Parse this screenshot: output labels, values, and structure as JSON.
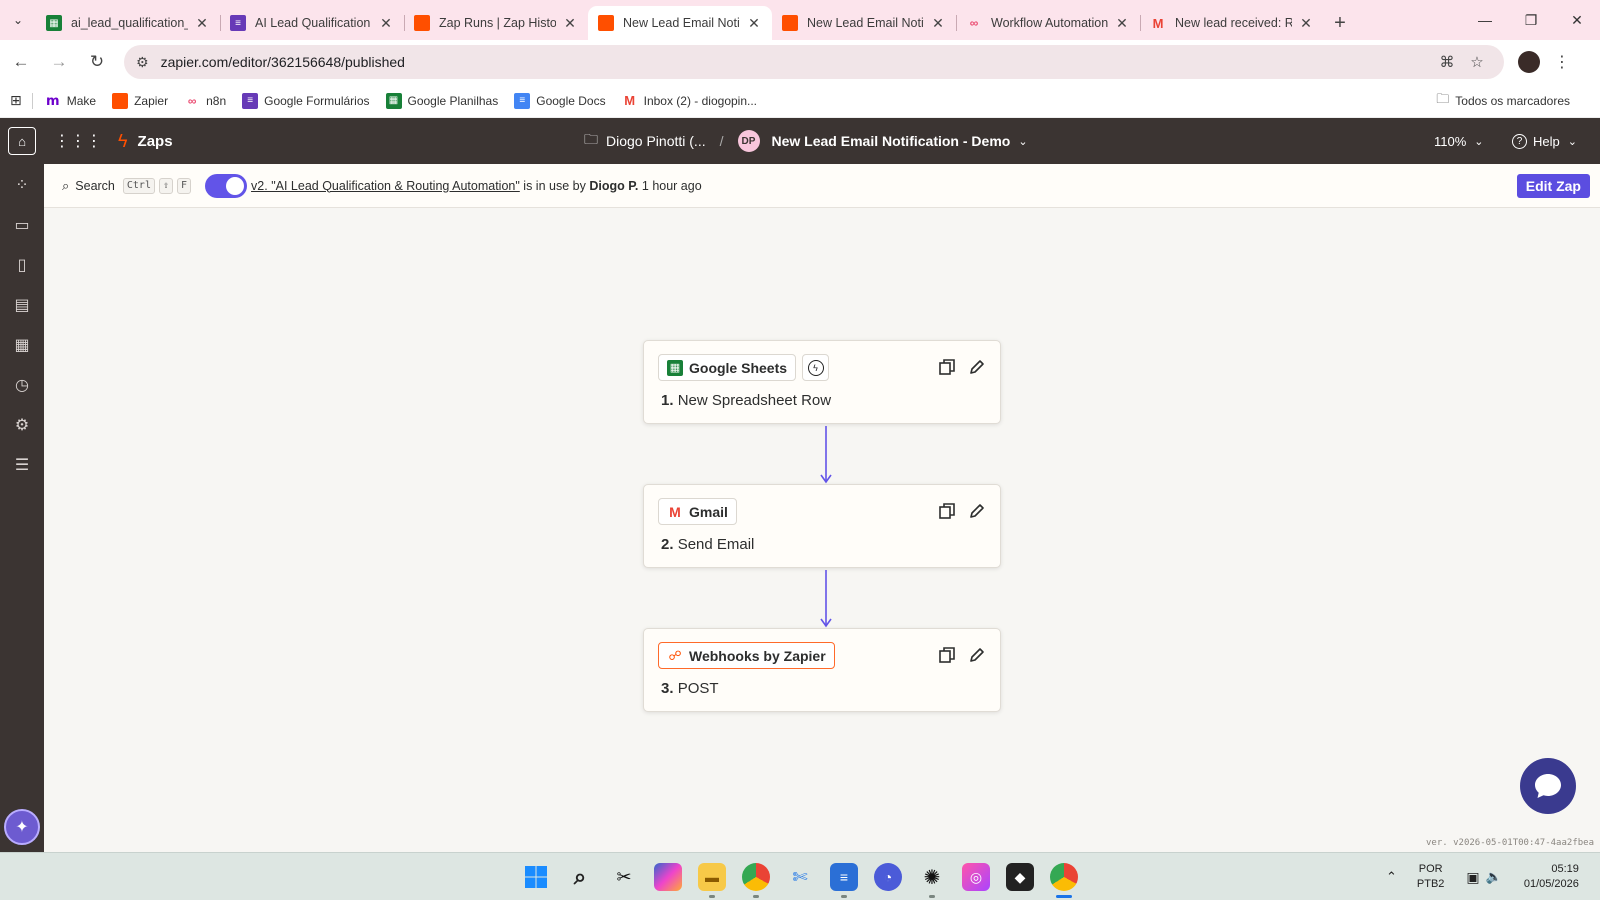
{
  "browser": {
    "tabs": [
      {
        "title": "ai_lead_qualification_au",
        "favicon": "sheets-icon",
        "color": "#188038",
        "active": false
      },
      {
        "title": "AI Lead Qualification F",
        "favicon": "forms-icon",
        "color": "#673ab7",
        "active": false
      },
      {
        "title": "Zap Runs | Zap History",
        "favicon": "zapier-icon",
        "color": "#ff4f00",
        "active": false
      },
      {
        "title": "New Lead Email Notific",
        "favicon": "zapier-icon",
        "color": "#ff4f00",
        "active": true
      },
      {
        "title": "New Lead Email Notific",
        "favicon": "zapier-icon",
        "color": "#ff4f00",
        "active": false
      },
      {
        "title": "Workflow Automation",
        "favicon": "n8n-icon",
        "color": "#ea4b71",
        "active": false
      },
      {
        "title": "New lead received: Raf",
        "favicon": "gmail-icon",
        "color": "#ea4335",
        "active": false
      }
    ],
    "url": "zapier.com/editor/362156648/published",
    "bookmarks": [
      {
        "label": "Make",
        "icon": "make-icon",
        "color": "#6d00cc"
      },
      {
        "label": "Zapier",
        "icon": "zapier-icon",
        "color": "#ff4f00"
      },
      {
        "label": "n8n",
        "icon": "n8n-icon",
        "color": "#ea4b71"
      },
      {
        "label": "Google Formulários",
        "icon": "forms-icon",
        "color": "#673ab7"
      },
      {
        "label": "Google Planilhas",
        "icon": "sheets-icon",
        "color": "#188038"
      },
      {
        "label": "Google Docs",
        "icon": "docs-icon",
        "color": "#4285f4"
      },
      {
        "label": "Inbox (2) - diogopin...",
        "icon": "gmail-icon",
        "color": "#ea4335"
      }
    ],
    "all_bookmarks": "Todos os marcadores"
  },
  "zapier": {
    "nav_label": "Zaps",
    "folder": "Diogo Pinotti (...",
    "owner_initials": "DP",
    "zap_name": "New Lead Email Notification - Demo",
    "zoom": "110%",
    "help": "Help",
    "search_label": "Search",
    "shortcut_keys": [
      "Ctrl",
      "⇧",
      "F"
    ],
    "status": {
      "version_link": "v2. \"AI Lead Qualification & Routing Automation\"",
      "middle": "is in use by",
      "user": "Diogo P.",
      "time": "1 hour ago"
    },
    "edit_button": "Edit Zap",
    "steps": [
      {
        "app": "Google Sheets",
        "number": "1.",
        "title": "New Spreadsheet Row",
        "is_trigger": true
      },
      {
        "app": "Gmail",
        "number": "2.",
        "title": "Send Email",
        "is_trigger": false
      },
      {
        "app": "Webhooks by Zapier",
        "number": "3.",
        "title": "POST",
        "is_trigger": false
      }
    ],
    "version_text": "ver. v2026-05-01T00:47-4aa2fbea"
  },
  "taskbar": {
    "language": "POR",
    "layout": "PTB2",
    "time": "05:19",
    "date": "01/05/2026"
  },
  "colors": {
    "zapier_orange": "#ff4f00",
    "zapier_purple": "#5b4de0",
    "connector": "#6254e8",
    "header_dark": "#3b3432"
  }
}
